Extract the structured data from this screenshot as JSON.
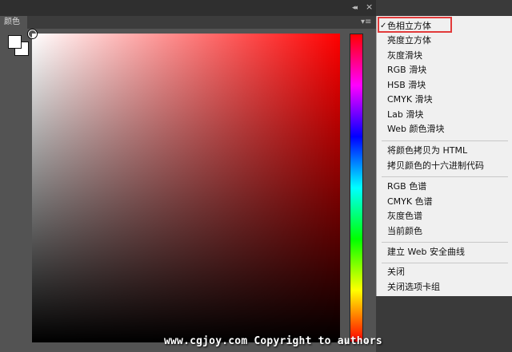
{
  "panel": {
    "tab_label": "颜色",
    "collapse_glyph": "◂◂",
    "close_glyph": "×",
    "menu_glyph": "▾≡"
  },
  "colors": {
    "hue": "#ff0000",
    "foreground": "#ffffff",
    "background": "#ffffff",
    "highlight_box": "#e23b3b"
  },
  "menu": {
    "checkmark": "✓",
    "items": [
      {
        "label": "色相立方体",
        "checked": true
      },
      {
        "label": "亮度立方体"
      },
      {
        "label": "灰度滑块"
      },
      {
        "label": "RGB 滑块"
      },
      {
        "label": "HSB 滑块"
      },
      {
        "label": "CMYK 滑块"
      },
      {
        "label": "Lab 滑块"
      },
      {
        "label": "Web 颜色滑块"
      },
      {
        "label": "将颜色拷贝为 HTML"
      },
      {
        "label": "拷贝颜色的十六进制代码"
      },
      {
        "label": "RGB 色谱"
      },
      {
        "label": "CMYK 色谱"
      },
      {
        "label": "灰度色谱"
      },
      {
        "label": "当前颜色"
      },
      {
        "label": "建立 Web 安全曲线"
      },
      {
        "label": "关闭"
      },
      {
        "label": "关闭选项卡组"
      }
    ]
  },
  "watermark": "www.cgjoy.com Copyright to authors"
}
